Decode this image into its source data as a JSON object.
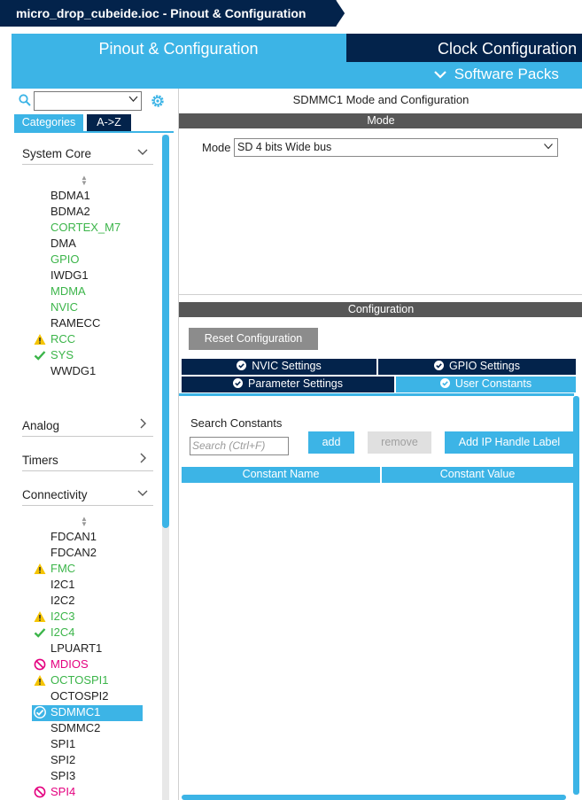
{
  "window": {
    "title": "micro_drop_cubeide.ioc - Pinout & Configuration"
  },
  "tabs": {
    "pinout": "Pinout & Configuration",
    "clock": "Clock Configuration",
    "software_packs": "Software Packs"
  },
  "left_panel": {
    "search": {
      "value": ""
    },
    "category_tabs": {
      "categories": "Categories",
      "az": "A->Z"
    },
    "sections": {
      "system_core": "System Core",
      "analog": "Analog",
      "timers": "Timers",
      "connectivity": "Connectivity"
    },
    "system_core_items": [
      {
        "label": "BDMA1",
        "status": "none"
      },
      {
        "label": "BDMA2",
        "status": "none"
      },
      {
        "label": "CORTEX_M7",
        "status": "ok"
      },
      {
        "label": "DMA",
        "status": "none"
      },
      {
        "label": "GPIO",
        "status": "ok"
      },
      {
        "label": "IWDG1",
        "status": "none"
      },
      {
        "label": "MDMA",
        "status": "ok"
      },
      {
        "label": "NVIC",
        "status": "ok"
      },
      {
        "label": "RAMECC",
        "status": "none"
      },
      {
        "label": "RCC",
        "status": "warning"
      },
      {
        "label": "SYS",
        "status": "check"
      },
      {
        "label": "WWDG1",
        "status": "none"
      }
    ],
    "connectivity_items": [
      {
        "label": "FDCAN1",
        "status": "none"
      },
      {
        "label": "FDCAN2",
        "status": "none"
      },
      {
        "label": "FMC",
        "status": "warning"
      },
      {
        "label": "I2C1",
        "status": "none"
      },
      {
        "label": "I2C2",
        "status": "none"
      },
      {
        "label": "I2C3",
        "status": "warning"
      },
      {
        "label": "I2C4",
        "status": "check"
      },
      {
        "label": "LPUART1",
        "status": "none"
      },
      {
        "label": "MDIOS",
        "status": "blocked"
      },
      {
        "label": "OCTOSPI1",
        "status": "warning"
      },
      {
        "label": "OCTOSPI2",
        "status": "none"
      },
      {
        "label": "SDMMC1",
        "status": "selected"
      },
      {
        "label": "SDMMC2",
        "status": "none"
      },
      {
        "label": "SPI1",
        "status": "none"
      },
      {
        "label": "SPI2",
        "status": "none"
      },
      {
        "label": "SPI3",
        "status": "none"
      },
      {
        "label": "SPI4",
        "status": "blocked"
      }
    ]
  },
  "right_panel": {
    "title": "SDMMC1 Mode and Configuration",
    "mode_header": "Mode",
    "mode_label": "Mode",
    "mode_value": "SD 4 bits Wide bus",
    "config_header": "Configuration",
    "reset_button": "Reset Configuration",
    "settings_tabs": {
      "nvic": "NVIC Settings",
      "gpio": "GPIO Settings",
      "parameter": "Parameter Settings",
      "user_constants": "User Constants"
    },
    "search_constants_label": "Search Constants",
    "search_constants_placeholder": "Search (Ctrl+F)",
    "buttons": {
      "add": "add",
      "remove": "remove",
      "add_ip": "Add IP Handle Label"
    },
    "table_headers": {
      "name": "Constant Name",
      "value": "Constant Value"
    }
  },
  "colors": {
    "accent": "#3cb4e6",
    "navy": "#03234b",
    "ok": "#3cb54a",
    "warning": "#f5c400",
    "blocked": "#e4007f",
    "header_gray": "#575757"
  }
}
